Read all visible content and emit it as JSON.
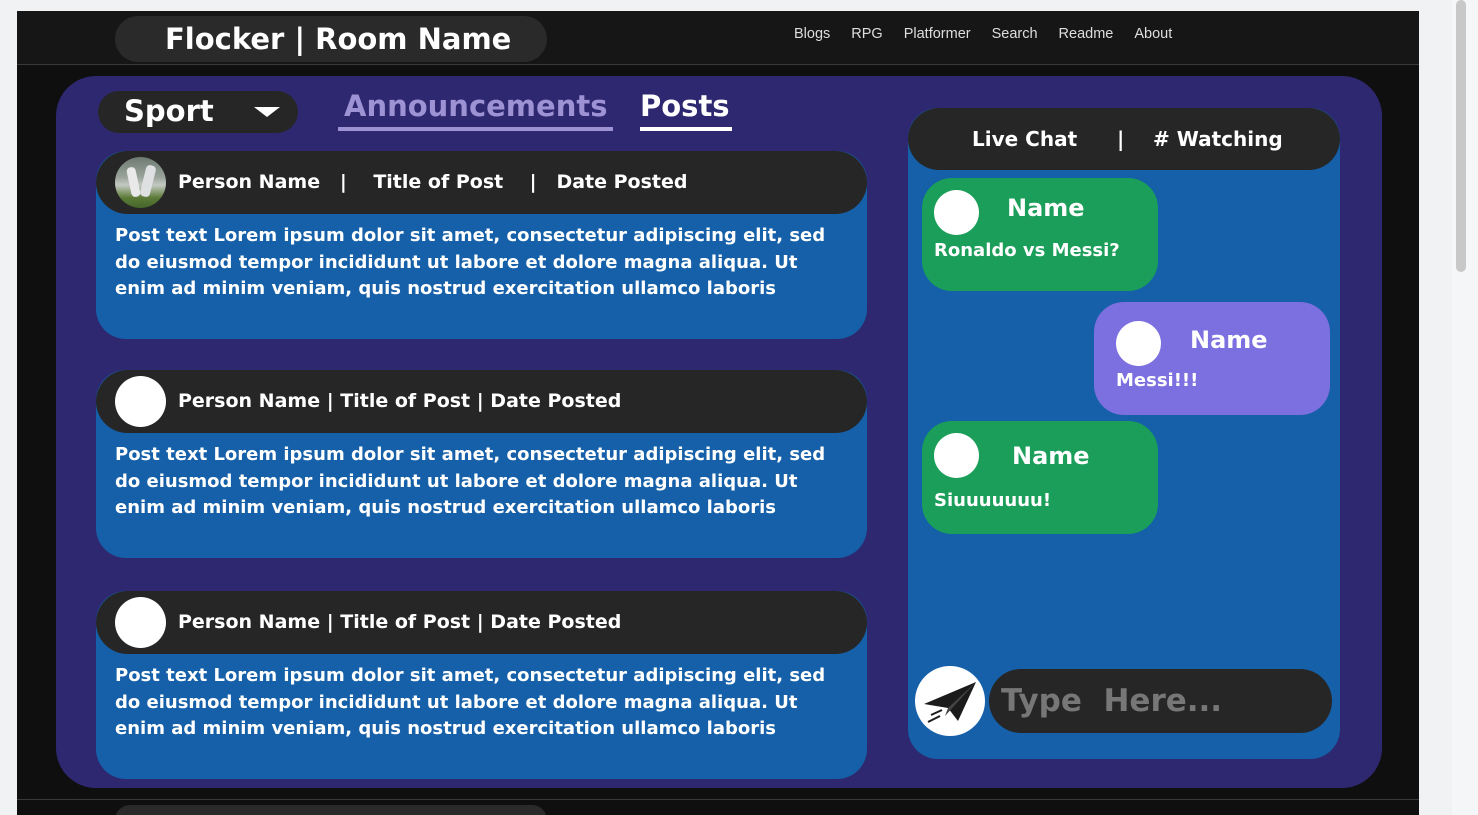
{
  "header": {
    "title": "Flocker | Room Name",
    "nav": [
      "Blogs",
      "RPG",
      "Platformer",
      "Search",
      "Readme",
      "About"
    ]
  },
  "filters": {
    "category": "Sport",
    "tabs": [
      "Announcements",
      "Posts"
    ],
    "active_tab": "Posts"
  },
  "posts": [
    {
      "header": "Person Name   |    Title of Post    |   Date Posted",
      "body": "Post text Lorem ipsum dolor sit amet, consectetur adipiscing elit, sed do eiusmod tempor incididunt ut labore et dolore magna aliqua. Ut enim ad minim veniam, quis nostrud exercitation ullamco laboris",
      "avatar": "photo"
    },
    {
      "header": "Person Name | Title of Post | Date Posted",
      "body": "Post text  Lorem ipsum dolor sit amet, consectetur adipiscing elit, sed do eiusmod tempor incididunt ut labore et dolore magna aliqua. Ut enim ad minim veniam, quis nostrud exercitation ullamco laboris",
      "avatar": "blank"
    },
    {
      "header": "Person Name | Title of Post | Date Posted",
      "body": "Post text  Lorem ipsum dolor sit amet, consectetur adipiscing elit, sed do eiusmod tempor incididunt ut labore et dolore magna aliqua. Ut enim ad minim veniam, quis nostrud exercitation ullamco laboris",
      "avatar": "blank"
    }
  ],
  "chat": {
    "title": "Live Chat",
    "separator": "|",
    "watching": "# Watching",
    "messages": [
      {
        "name": "Name",
        "text": "Ronaldo vs Messi?",
        "color": "#1a9e59"
      },
      {
        "name": "Name",
        "text": "Messi!!!",
        "color": "#7c6fe0"
      },
      {
        "name": "Name",
        "text": "Siuuuuuuu!",
        "color": "#1a9e59"
      }
    ],
    "input_placeholder": "Type  Here..."
  },
  "colors": {
    "panel": "#2e2870",
    "card": "#1560a8",
    "header_bar": "#262626",
    "accent_tab": "#9d92d4"
  }
}
